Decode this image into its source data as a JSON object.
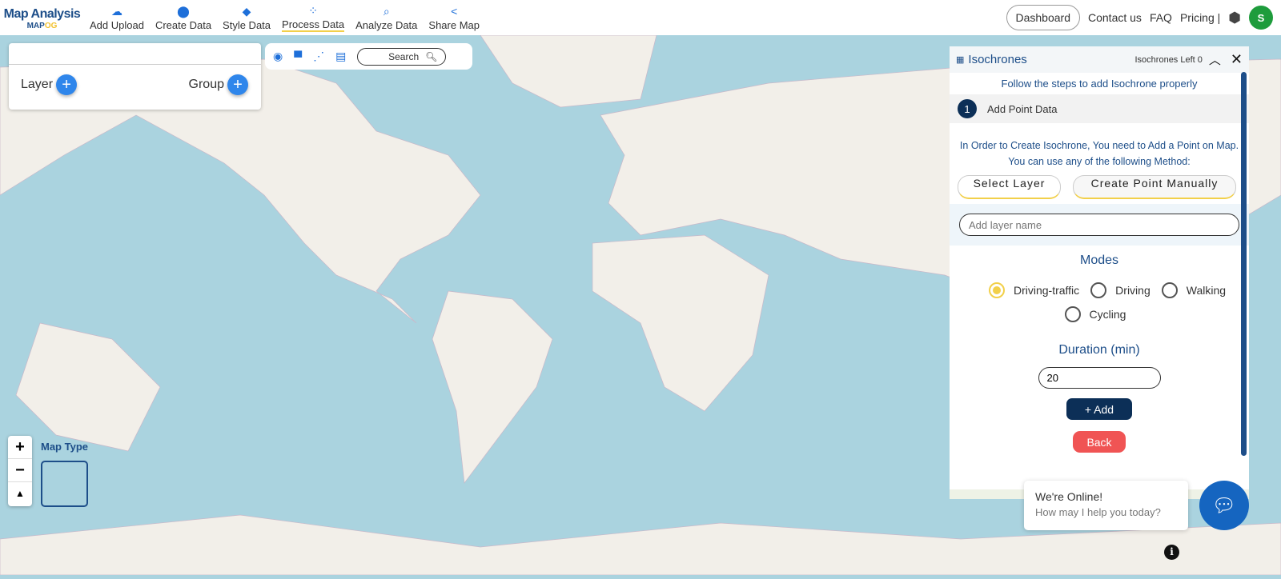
{
  "brand": {
    "title": "Map Analysis",
    "logo": "MAPOG"
  },
  "nav": [
    {
      "label": "Add Upload",
      "icon": "cloud-upload-icon"
    },
    {
      "label": "Create Data",
      "icon": "map-pin-icon"
    },
    {
      "label": "Style Data",
      "icon": "paint-bucket-icon"
    },
    {
      "label": "Process Data",
      "icon": "process-icon",
      "active": true
    },
    {
      "label": "Analyze Data",
      "icon": "analyze-icon"
    },
    {
      "label": "Share Map",
      "icon": "share-icon"
    }
  ],
  "header": {
    "dashboard": "Dashboard",
    "contact": "Contact us",
    "faq": "FAQ",
    "pricing": "Pricing |",
    "avatar": "S"
  },
  "layers": {
    "layer": "Layer",
    "group": "Group"
  },
  "toolbar": {
    "search": "Search"
  },
  "map": {
    "map_type": "Map Type",
    "zoom_in": "+",
    "zoom_out": "−",
    "reset": "▲"
  },
  "panel": {
    "title": "Isochrones",
    "left": "Isochrones Left 0",
    "subtitle": "Follow the steps to add Isochrone properly",
    "step_num": "1",
    "step_title": "Add Point Data",
    "description": "In Order to Create Isochrone, You need to Add a Point on Map. You can use any of the following Method:",
    "select_layer": "Select Layer",
    "create_point": "Create Point Manually",
    "layer_placeholder": "Add layer name",
    "modes_label": "Modes",
    "modes": [
      {
        "label": "Driving-traffic",
        "selected": true
      },
      {
        "label": "Driving",
        "selected": false
      },
      {
        "label": "Walking",
        "selected": false
      },
      {
        "label": "Cycling",
        "selected": false
      }
    ],
    "duration_label": "Duration (min)",
    "duration": "20",
    "add": "+  Add",
    "back": "Back"
  },
  "chat": {
    "title": "We're Online!",
    "subtitle": "How may I help you today?"
  },
  "colors": {
    "accent": "#1d4e89",
    "highlight": "#f2d04a",
    "back": "#f05454",
    "water": "#aad3df",
    "land": "#f2efe9"
  }
}
